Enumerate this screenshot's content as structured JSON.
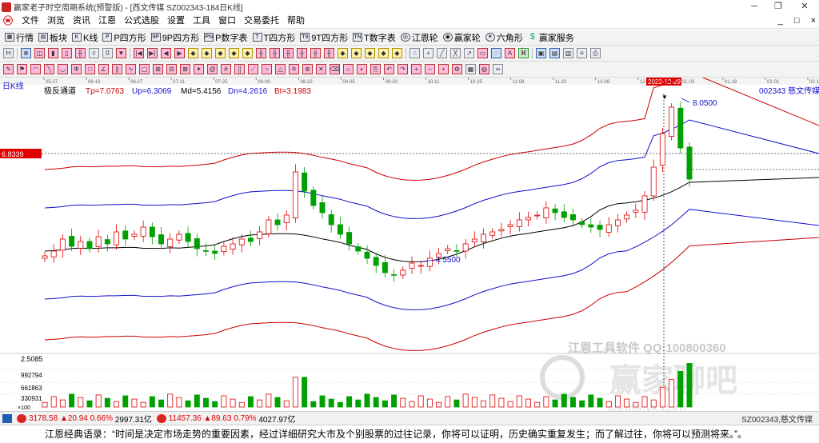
{
  "window": {
    "title": "赢家老子时空周期系统(预警版) - [西文传媒  SZ002343-184日K线]",
    "minimize": "─",
    "maximize": "❐",
    "close": "✕"
  },
  "menu": {
    "items": [
      "文件",
      "浏览",
      "资讯",
      "江恩",
      "公式选股",
      "设置",
      "工具",
      "窗口",
      "交易委托",
      "帮助"
    ],
    "right": [
      "_",
      "□",
      "×"
    ]
  },
  "toolbar": {
    "buttons": [
      {
        "label": "行情",
        "icon": "grid-icon"
      },
      {
        "label": "板块",
        "icon": "blocks-icon"
      },
      {
        "label": "K线",
        "icon": "kline-icon"
      },
      {
        "label": "P四方形",
        "icon": "p-square-icon"
      },
      {
        "label": "9P四方形",
        "icon": "9p-square-icon"
      },
      {
        "label": "P数字表",
        "icon": "p-table-icon"
      },
      {
        "label": "T四方形",
        "icon": "t-square-icon"
      },
      {
        "label": "9T四方形",
        "icon": "9t-square-icon"
      },
      {
        "label": "T数字表",
        "icon": "t-table-icon"
      },
      {
        "label": "江恩轮",
        "icon": "gann-wheel-icon"
      },
      {
        "label": "赢家轮",
        "icon": "winner-wheel-icon"
      },
      {
        "label": "六角形",
        "icon": "hexagon-icon"
      },
      {
        "label": "赢家服务",
        "icon": "dollar-icon"
      }
    ]
  },
  "chart": {
    "period_label": "日K线",
    "indicator_name": "极反通道",
    "tp_label": "Tp=7.0763",
    "up_label": "Up=6.3069",
    "md_label": "Md=5.4156",
    "dn_label": "Dn=4.2616",
    "bt_label": "Bt=3.1983",
    "stock_label": "002343  慈文传媒",
    "cursor_date": "2022-12-29",
    "price_marker": "6.8339",
    "high_label": "8.0500",
    "low_label": "4.5500",
    "vol_axis": [
      "2.5085",
      "992794",
      "661863",
      "330931"
    ],
    "vol_unit": "×100",
    "watermark": "江恩工具软件  QQ:100800360",
    "watermark_big": "赢家聊吧",
    "watermark_url": "jiaoba.yk.com",
    "date_ticks": [
      "05-27",
      "06-13",
      "06-27",
      "07-11",
      "07-25",
      "08-08",
      "08-22",
      "09-05",
      "09-20",
      "10-11",
      "10-25",
      "11-08",
      "11-22",
      "12-06",
      "12-20",
      "01-03",
      "01-18",
      "02-01",
      "02-15"
    ],
    "colors": {
      "up": "#e00000",
      "down": "#00a000",
      "channel_outer": "#cc0000",
      "channel_inner": "#1010cc",
      "mid": "#000000",
      "highlight": "#e00000"
    }
  },
  "chart_data": {
    "type": "candlestick",
    "title": "",
    "x_range": [
      "05-27",
      "02-15"
    ],
    "y_range": [
      3.0,
      8.3
    ],
    "price_close_sample": [
      4.95,
      5.05,
      5.3,
      5.15,
      5.25,
      5.1,
      5.35,
      5.2,
      5.45,
      5.3,
      5.4,
      5.55,
      5.35,
      5.2,
      5.3,
      5.4,
      5.25,
      5.1,
      5.05,
      5.0,
      5.15,
      5.2,
      5.3,
      5.25,
      5.45,
      5.7,
      5.6,
      5.8,
      6.7,
      6.3,
      6.0,
      5.85,
      5.6,
      5.4,
      5.2,
      5.05,
      4.9,
      4.75,
      4.6,
      4.55,
      4.65,
      4.8,
      4.75,
      4.9,
      5.0,
      5.1,
      5.05,
      5.2,
      5.3,
      5.4,
      5.45,
      5.5,
      5.6,
      5.7,
      5.75,
      5.8,
      5.95,
      5.85,
      5.75,
      5.7,
      5.6,
      5.55,
      5.5,
      5.6,
      5.7,
      5.8,
      5.9,
      6.2,
      6.8,
      7.5,
      8.05,
      7.2,
      6.55
    ],
    "volume_scale": [
      0,
      330931,
      661863,
      992794
    ],
    "series": [
      {
        "name": "Tp",
        "last": 7.0763
      },
      {
        "name": "Up",
        "last": 6.3069
      },
      {
        "name": "Md",
        "last": 5.4156
      },
      {
        "name": "Dn",
        "last": 4.2616
      },
      {
        "name": "Bt",
        "last": 3.1983
      }
    ],
    "annotations": [
      {
        "text": "8.0500",
        "type": "high"
      },
      {
        "text": "4.5500",
        "type": "low"
      },
      {
        "text": "2022-12-29",
        "type": "cursor-date"
      }
    ]
  },
  "status": {
    "sh_index": "3178.58",
    "sh_change": "▲20.94",
    "sh_pct": "0.66%",
    "sh_amount": "2997.31亿",
    "sz_index": "11457.36",
    "sz_change": "▲89.63",
    "sz_pct": "0.79%",
    "sz_amount": "4027.97亿",
    "stock_code": "SZ002343,慈文传媒"
  },
  "quote": {
    "text": "江恩经典语录：“时间是决定市场走势的重要因素，经过详细研究大市及个别股票的过往记录，你将可以证明，历史确实重复发生；而了解过往，你将可以预测将来。”。"
  }
}
